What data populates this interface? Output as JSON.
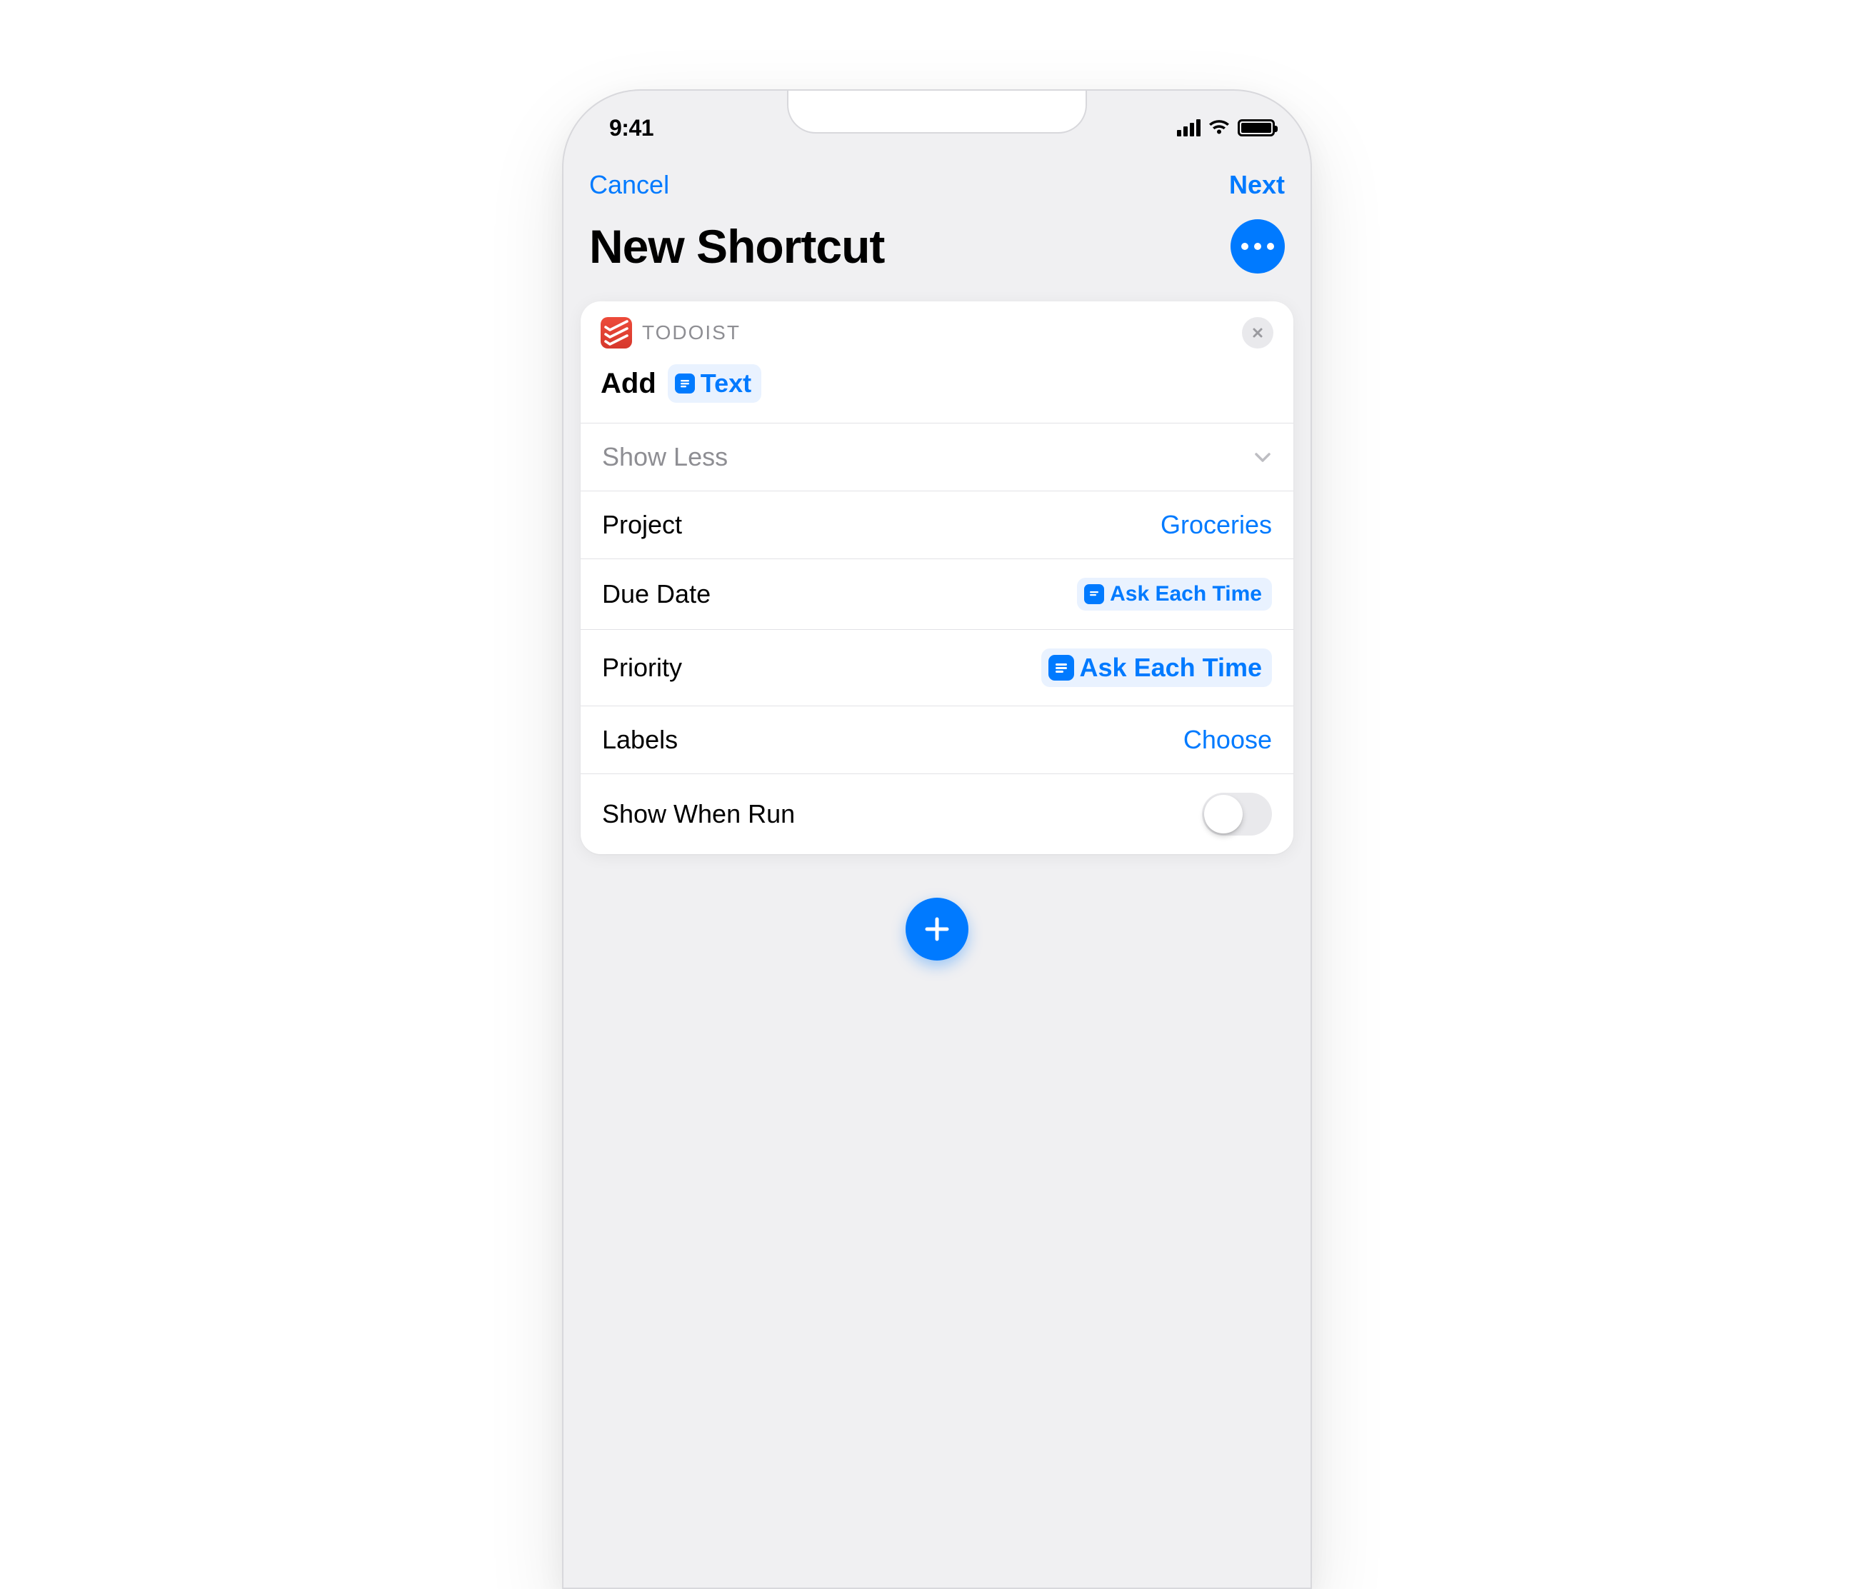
{
  "status": {
    "time": "9:41"
  },
  "nav": {
    "cancel": "Cancel",
    "next": "Next"
  },
  "header": {
    "title": "New Shortcut"
  },
  "card": {
    "app_name": "TODOIST",
    "action": {
      "verb": "Add",
      "variable": "Text"
    },
    "show_less": "Show Less",
    "rows": {
      "project": {
        "label": "Project",
        "value": "Groceries"
      },
      "due_date": {
        "label": "Due Date",
        "value": "Ask Each Time"
      },
      "priority": {
        "label": "Priority",
        "value": "Ask Each Time"
      },
      "labels": {
        "label": "Labels",
        "value": "Choose"
      },
      "show_when_run": {
        "label": "Show When Run",
        "on": false
      }
    }
  }
}
